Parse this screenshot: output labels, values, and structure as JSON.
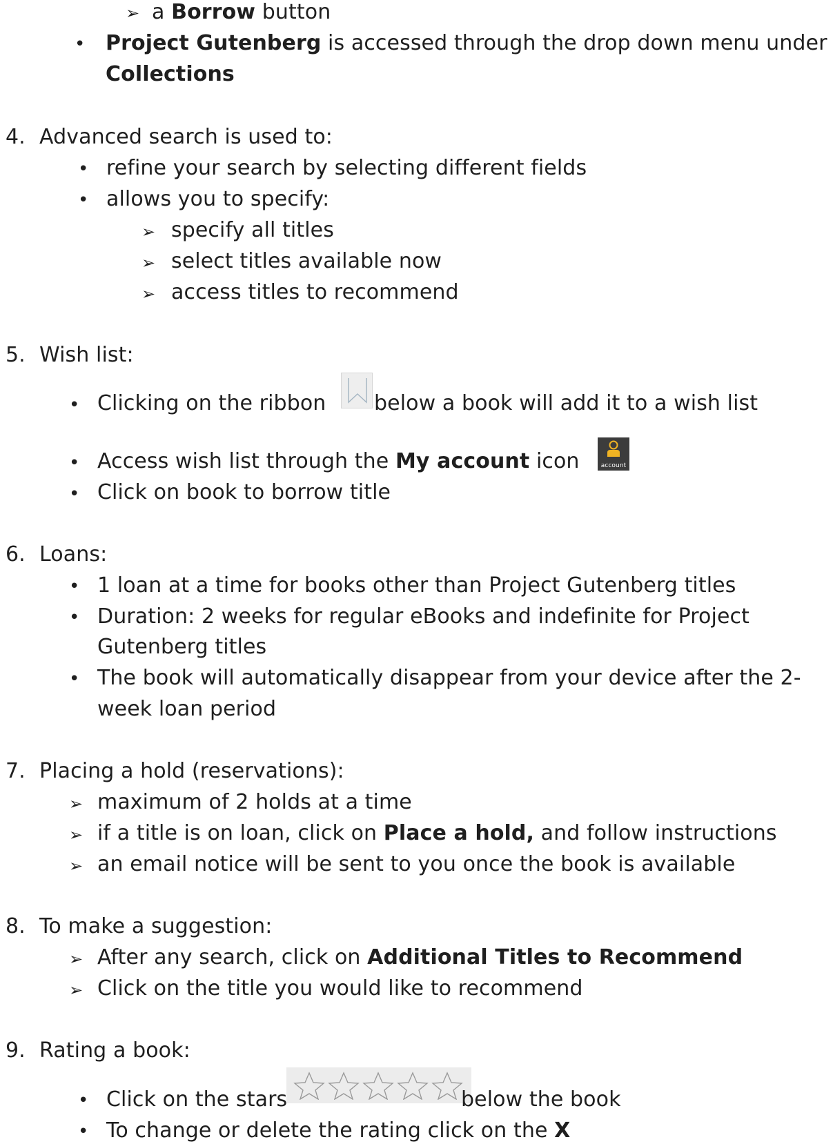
{
  "section3": {
    "borrow_pre": "a ",
    "borrow_bold": "Borrow",
    "borrow_post": " button",
    "gutenberg_bold": "Project Gutenberg",
    "gutenberg_text": " is accessed through the drop down menu under",
    "collections_bold": "Collections"
  },
  "section4": {
    "number": "4.",
    "heading": "Advanced search is used to:",
    "bullet1": "refine your search by selecting different fields",
    "bullet2": "allows you to specify:",
    "sub1": "specify all titles",
    "sub2": "select titles available now",
    "sub3": "access titles to recommend"
  },
  "section5": {
    "number": "5.",
    "heading": "Wish list:",
    "ribbon_pre": "Clicking on the ribbon ",
    "ribbon_post": "below a book will add it to a wish list",
    "access_pre": "Access wish list through the ",
    "access_bold": "My account",
    "access_post": " icon ",
    "account_icon_label": "account",
    "click_book": "Click on book to borrow title"
  },
  "section6": {
    "number": "6.",
    "heading": "Loans:",
    "bullet1": "1 loan at a time for books other than Project Gutenberg titles",
    "bullet2_l1": "Duration: 2 weeks for regular eBooks and indefinite for Project",
    "bullet2_l2": "Gutenberg titles",
    "bullet3_l1": "The book will automatically disappear from your device after the 2-",
    "bullet3_l2": "week loan period"
  },
  "section7": {
    "number": "7.",
    "heading": "Placing a hold (reservations):",
    "sub1": "maximum of 2 holds at a time",
    "sub2_pre": "if a title is on loan,  click on ",
    "sub2_bold": "Place a hold,",
    "sub2_post": " and follow instructions",
    "sub3": "an email notice will be sent to you once the book is available"
  },
  "section8": {
    "number": "8.",
    "heading": "To make a suggestion:",
    "sub1_pre": "After any search, click on ",
    "sub1_bold": "Additional Titles to Recommend",
    "sub2": "Click on the title you would like to recommend"
  },
  "section9": {
    "number": "9.",
    "heading": "Rating a book:",
    "stars_pre": "Click on the stars ",
    "stars_post": " below the book",
    "change_pre": "To change or delete the rating click on the ",
    "change_bold": "X"
  },
  "glyphs": {
    "bullet": "•",
    "arrow": "➢"
  },
  "colors": {
    "account_icon_bg": "#3c3c3c",
    "account_icon_accent": "#f0b323"
  }
}
